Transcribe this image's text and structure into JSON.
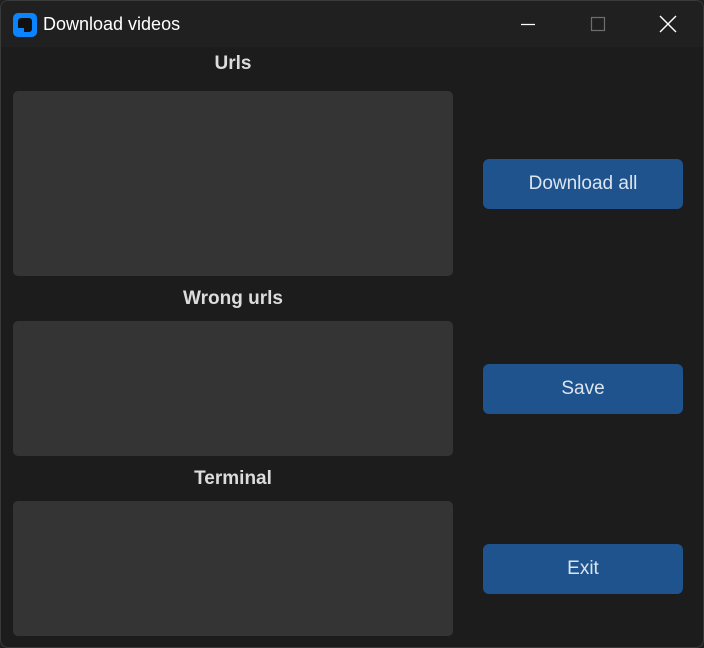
{
  "window": {
    "title": "Download videos",
    "icon": "app-icon",
    "controls": {
      "minimize": "minimize-icon",
      "maximize": "maximize-icon",
      "close": "close-icon"
    }
  },
  "sections": {
    "urls_label": "Urls",
    "wrong_urls_label": "Wrong urls",
    "terminal_label": "Terminal"
  },
  "buttons": {
    "download_all": "Download all",
    "save": "Save",
    "exit": "Exit"
  },
  "colors": {
    "accent": "#1f538d",
    "window_bg": "#1c1c1c",
    "textbox_bg": "#343434",
    "app_icon": "#0a84ff"
  }
}
